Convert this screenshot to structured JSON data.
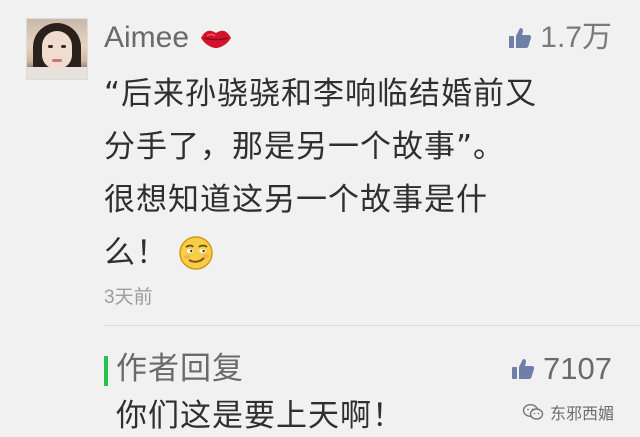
{
  "comment": {
    "username": "Aimee",
    "user_icon": "lips-icon",
    "likes": "1.7万",
    "text_lines": [
      "“后来孙骁骁和李响临结婚前又",
      "分手了，那是另一个故事”。",
      "很想知道这另一个故事是什",
      "么！"
    ],
    "emoji": "smirk-emoji",
    "time": "3天前"
  },
  "reply": {
    "title": "作者回复",
    "likes": "7107",
    "text": "你们这是要上天啊！"
  },
  "watermark": {
    "label": "东邪西媚",
    "icon": "wechat-icon"
  },
  "colors": {
    "background": "#f1f1f1",
    "reply_accent": "#27c24c",
    "thumb_icon": "#6f7fa8",
    "lips": "#d1142b"
  }
}
